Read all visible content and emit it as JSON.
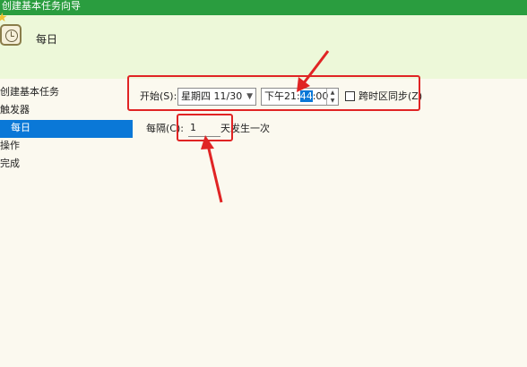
{
  "window": {
    "title": "创建基本任务向导"
  },
  "header": {
    "title": "每日"
  },
  "sidebar": {
    "items": [
      {
        "label": "创建基本任务"
      },
      {
        "label": "触发器"
      },
      {
        "label": "每日"
      },
      {
        "label": "操作"
      },
      {
        "label": "完成"
      }
    ]
  },
  "trigger": {
    "start_label": "开始(S):",
    "date_value": "星期四 11/30",
    "time_prefix": "下午21:",
    "time_minutes": "44",
    "time_suffix": ":00",
    "sync_label": "跨时区同步(Z)",
    "sync_checked": false,
    "recur_label": "每隔(C):",
    "recur_value": "1",
    "recur_suffix": "天发生一次"
  },
  "colors": {
    "titlebar": "#2a9d3f",
    "header_bg": "#edf8d9",
    "selection": "#0a78d7",
    "highlight": "#e02424"
  }
}
